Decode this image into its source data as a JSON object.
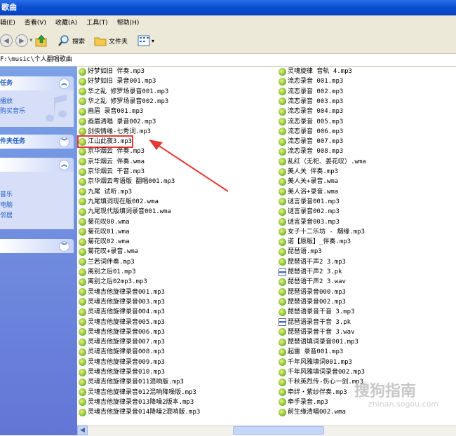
{
  "window": {
    "title": "歌曲"
  },
  "menu": [
    "辑(E)",
    "查看(V)",
    "收藏(A)",
    "工具(T)",
    "帮助(H)"
  ],
  "toolbar": {
    "search": "搜索",
    "folders": "文件夹"
  },
  "address": {
    "path": "F:\\music\\个人翻唱歌曲"
  },
  "leftpane": {
    "tasks_title": "任务",
    "tasks_items": [
      "播放",
      "购买音乐"
    ],
    "folder_tasks_title": "件夹任务",
    "other_items": [
      "音乐",
      "电脑",
      "邻居"
    ]
  },
  "files_col1": [
    "好梦如旧 伴奏.mp3",
    "好梦如旧 录音001.mp3",
    "华之乱 修罗场录音001.mp3",
    "华之乱 修罗场录音002.mp3",
    "画眉 录音001.mp3",
    "画眉清唱 录音002.mp3",
    "剑侠情缘-七秀词.mp3",
    "江山此夜3.mp3",
    "京华烟云 伴奏.mp3",
    "京华烟云 伴奏.wma",
    "京华烟云 干音.mp3",
    "京华烟云粤语版 翻唱001.mp3",
    "九尾 试听.mp3",
    "九尾填词现在版002.wma",
    "九尾现代版填词录音001.wma",
    "菊花叹00.wma",
    "菊花叹01.wma",
    "菊花叹02.wma",
    "菊花叹+录音.wma",
    "兰若词伴奏.mp3",
    "离别之后01.mp3",
    "离别之后02mp3.mp3",
    "灵魂吉他旋律录音001.mp3",
    "灵魂吉他旋律录音003.mp3",
    "灵魂吉他旋律录音004.mp3",
    "灵魂吉他旋律录音005.mp3",
    "灵魂吉他旋律录音006.mp3",
    "灵魂吉他旋律录音007.mp3",
    "灵魂吉他旋律录音008.mp3",
    "灵魂吉他旋律录音009.mp3",
    "灵魂吉他旋律录音010.mp3",
    "灵魂吉他旋律录音011混响版.mp3",
    "灵魂吉他旋律录音012混响降噪版.mp3",
    "灵魂吉他旋律录音013降噪2版本.mp3",
    "灵魂吉他旋律录音014降噪2混响版.mp3"
  ],
  "files_col2": [
    "灵魂旋律 音轨 4.mp3",
    "流恋录音 001.mp3",
    "流恋录音 002.mp3",
    "流恋录音 003.mp3",
    "流恋录音 004.mp3",
    "流恋录音 005.mp3",
    "流恋录音 006.mp3",
    "流恋录音 007.mp3",
    "流恋录音 008.mp3",
    "乱红（无祀、姜花叹）.wma",
    "美人关 伴奏.mp3",
    "美人关+录音.wma",
    "美人浴+录音.wma",
    "谜言录音001.mp3",
    "谜言录音002.mp3",
    "谜言录音003.mp3",
    "女子十二乐坊 - 烟缘.mp3",
    "诺【原版】_伴奏.mp3",
    "琵琶语.mp3",
    "琵琶语干声2 3.mp3",
    "琵琶语干声2 3.pk",
    "琵琶语干声2 3.wav",
    "琵琶语录音000.mp3",
    "琵琶语录音002.mp3",
    "琵琶语录音干音 3.mp3",
    "琵琶语录音干音 3.pk",
    "琵琶语录音干音 3.wav",
    "琵琶语填词录音001.mp3",
    "起雷 录音001.mp3",
    "千年风雅填词001.mp3",
    "千年风雅填词录音002.mp3",
    "千秋英烈传-伤心一剑.mp3",
    "牵绊・紫纱伴奏.mp3",
    "牵手录音.mp3",
    "前生缘清唱002.wma"
  ],
  "col2_doc_indexes": [
    20,
    25
  ],
  "highlight_index": 7,
  "watermark": {
    "main": "搜狗指南",
    "sub": "zhinan.sogou.com"
  },
  "colors": {
    "title_bar": "#0a4fd0",
    "highlight": "#e53935",
    "pane": "#6375d6"
  }
}
